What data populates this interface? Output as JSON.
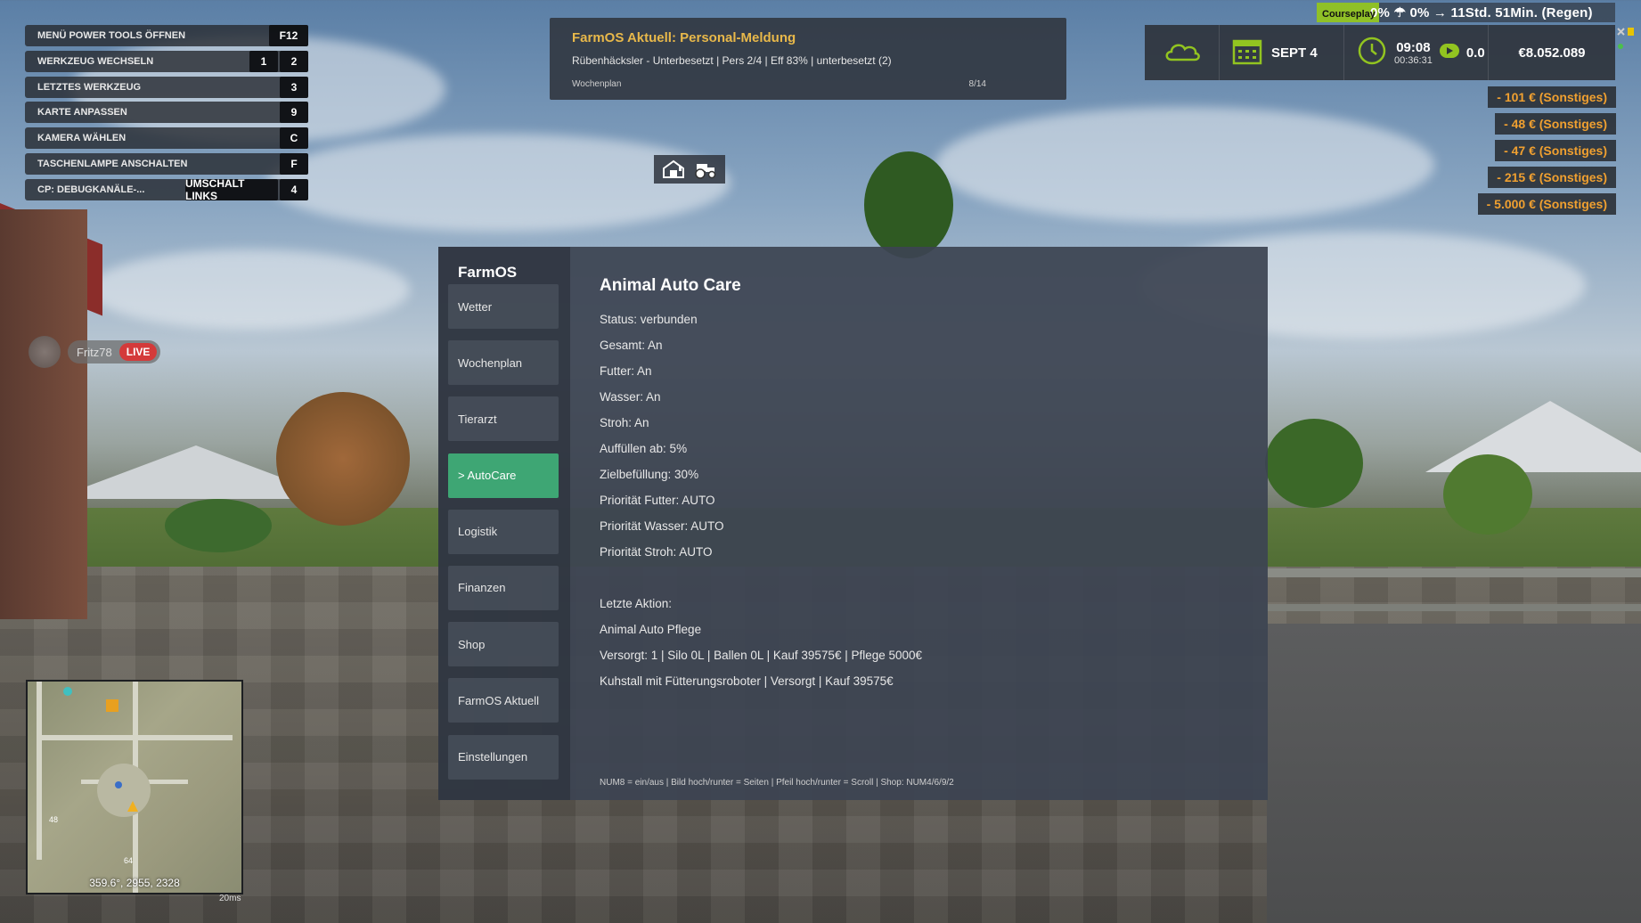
{
  "keybinds": [
    {
      "label": "MENÜ POWER TOOLS ÖFFNEN",
      "keys": [
        "F12"
      ]
    },
    {
      "label": "WERKZEUG WECHSELN",
      "keys": [
        "1",
        "2"
      ]
    },
    {
      "label": "LETZTES WERKZEUG",
      "keys": [
        "3"
      ]
    },
    {
      "label": "KARTE ANPASSEN",
      "keys": [
        "9"
      ]
    },
    {
      "label": "KAMERA WÄHLEN",
      "keys": [
        "C"
      ]
    },
    {
      "label": "TASCHENLAMPE ANSCHALTEN",
      "keys": [
        "F"
      ]
    },
    {
      "label": "CP: DEBUGKANÄLE-...",
      "keys": [
        "UMSCHALT LINKS",
        "4"
      ]
    }
  ],
  "streamer": {
    "name": "Fritz78",
    "live": "LIVE"
  },
  "notification": {
    "title": "FarmOS Aktuell: Personal-Meldung",
    "text": "Rübenhäcksler - Unterbesetzt | Pers 2/4 | Eff 83% | unterbesetzt (2)",
    "source": "Wochenplan",
    "counter": "8/14"
  },
  "hud": {
    "date": "SEPT 4",
    "time": "09:08",
    "playtime": "00:36:31",
    "speed": "0.0",
    "money": "€8.052.089",
    "weather_line": "0%  ☂ 0% → 11Std. 51Min. (Regen)",
    "courseplay": "Courseplay",
    "accent": "#92c420"
  },
  "expenses": [
    "- 101 € (Sonstiges)",
    "- 48 € (Sonstiges)",
    "- 47 € (Sonstiges)",
    "- 215 € (Sonstiges)",
    "- 5.000 € (Sonstiges)"
  ],
  "farmos": {
    "logo": "FarmOS",
    "menu": [
      "Wetter",
      "Wochenplan",
      "Tierarzt",
      "> AutoCare",
      "Logistik",
      "Finanzen",
      "Shop",
      "FarmOS Aktuell",
      "Einstellungen"
    ],
    "active_index": 3,
    "active_color": "#3ea674",
    "title": "Animal Auto Care",
    "lines": [
      "Status: verbunden",
      "Gesamt: An",
      "Futter: An",
      "Wasser: An",
      "Stroh: An",
      "Auffüllen ab: 5%",
      "Zielbefüllung: 30%",
      "Priorität Futter: AUTO",
      "Priorität Wasser: AUTO",
      "Priorität Stroh: AUTO"
    ],
    "last_action_label": "Letzte Aktion:",
    "last_action_lines": [
      "Animal Auto Pflege",
      "Versorgt: 1 | Silo 0L | Ballen 0L | Kauf 39575€ | Pflege 5000€",
      "Kuhstall mit Fütterungsroboter | Versorgt | Kauf 39575€"
    ],
    "hint": "NUM8 = ein/aus | Bild hoch/runter = Seiten | Pfeil hoch/runter = Scroll | Shop: NUM4/6/9/2"
  },
  "minimap": {
    "coords": "359.6°, 2955, 2328",
    "zoom": "20ms",
    "label_a": "48",
    "label_b": "64"
  }
}
